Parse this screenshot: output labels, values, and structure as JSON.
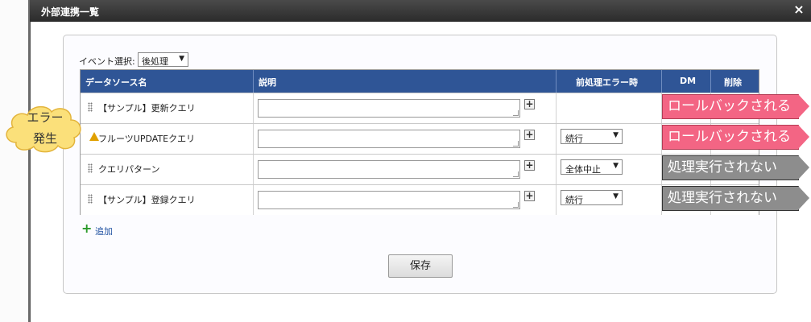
{
  "dialog": {
    "title": "外部連携一覧",
    "close_label": "×"
  },
  "event": {
    "label": "イベント選択:",
    "selected": "後処理"
  },
  "table": {
    "headers": {
      "source": "データソース名",
      "description": "説明",
      "pre_error": "前処理エラー時",
      "dm": "DM",
      "delete": "削除"
    },
    "rows": [
      {
        "name": "【サンプル】更新クエリ",
        "description": "",
        "pre_error": ""
      },
      {
        "name": "フルーツUPDATEクエリ",
        "description": "",
        "pre_error": "続行"
      },
      {
        "name": "クエリパターン",
        "description": "",
        "pre_error": "全体中止"
      },
      {
        "name": "【サンプル】登録クエリ",
        "description": "",
        "pre_error": "続行"
      }
    ]
  },
  "annotations": {
    "error_cloud_line1": "エラー",
    "error_cloud_line2": "発生",
    "tags": [
      "ロールバックされる",
      "ロールバックされる",
      "処理実行されない",
      "処理実行されない"
    ],
    "colors": {
      "rollback": "#f36584",
      "not_executed": "#8d8d8d",
      "header": "#2f5596"
    }
  },
  "add_label": "追加",
  "save_label": "保存"
}
